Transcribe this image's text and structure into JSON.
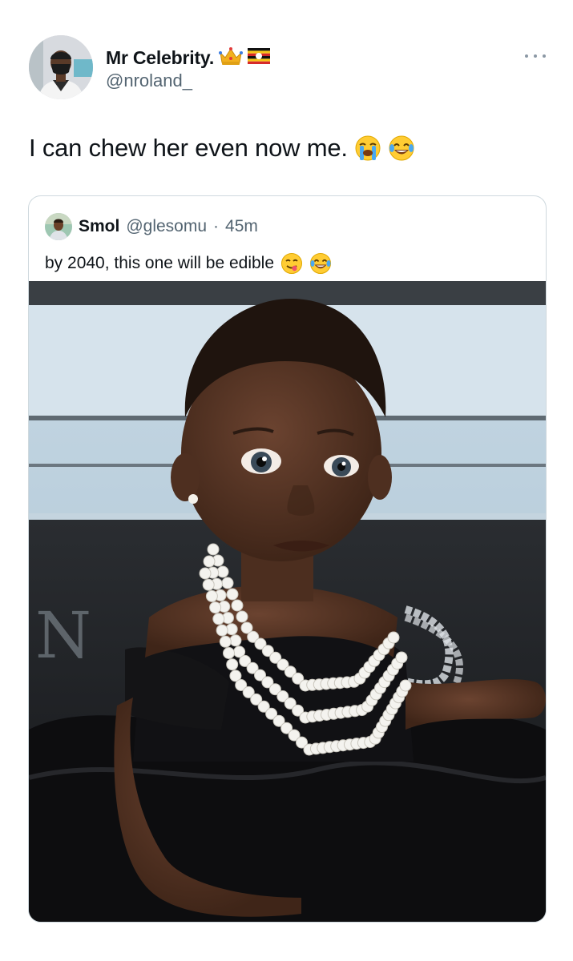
{
  "tweet": {
    "author": {
      "display_name": "Mr Celebrity.",
      "handle": "@nroland_",
      "badges": [
        "crown-icon",
        "uganda-flag-icon"
      ]
    },
    "text": "I can chew her even now me.",
    "text_emojis": [
      "loudly-crying-face-emoji",
      "face-with-tears-of-joy-emoji"
    ],
    "menu_icon": "more-horizontal-icon"
  },
  "quoted_tweet": {
    "author": {
      "display_name": "Smol",
      "handle": "@glesomu"
    },
    "separator": "·",
    "time": "45m",
    "text": "by 2040, this one will be edible",
    "text_emojis": [
      "face-savoring-food-emoji",
      "face-with-tears-of-joy-emoji"
    ],
    "media": {
      "type": "photo",
      "subject": "baby-photo"
    }
  },
  "colors": {
    "text_primary": "#0f1419",
    "text_secondary": "#536471",
    "card_border": "#cfd9de",
    "menu_dots": "#8b98a5"
  }
}
